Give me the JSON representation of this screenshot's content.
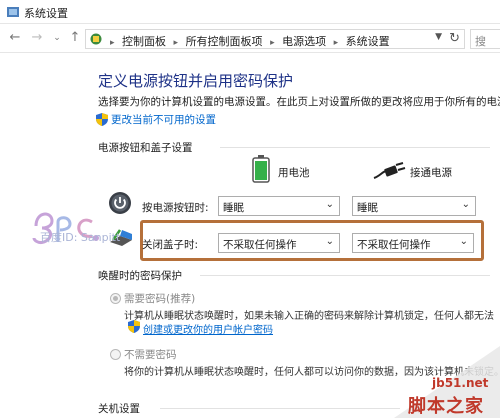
{
  "window": {
    "title": "系统设置"
  },
  "address": {
    "crumbs": [
      "控制面板",
      "所有控制面板项",
      "电源选项",
      "系统设置"
    ],
    "search_partial": "搜"
  },
  "page": {
    "title": "定义电源按钮并启用密码保护",
    "description": "选择要为你的计算机设置的电源设置。在此页上对设置所做的更改将应用于你所有的电源计",
    "change_unavailable_link": "更改当前不可用的设置"
  },
  "power_section": {
    "title": "电源按钮和盖子设置",
    "col_battery": "用电池",
    "col_plugged": "接通电源",
    "rows": [
      {
        "label": "按电源按钮时:",
        "battery": "睡眠",
        "plugged": "睡眠"
      },
      {
        "label": "关闭盖子时:",
        "battery": "不采取任何操作",
        "plugged": "不采取任何操作"
      }
    ]
  },
  "wake_section": {
    "title": "唤醒时的密码保护",
    "options": [
      {
        "label": "需要密码(推荐)",
        "desc": "计算机从睡眠状态唤醒时，如果未输入正确的密码来解除计算机锁定，任何人都无法",
        "link": "创建或更改你的用户帐户密码",
        "selected": true
      },
      {
        "label": "不需要密码",
        "desc": "将你的计算机从睡眠状态唤醒时，任何人都可以访问你的数据，因为该计算机未锁定。",
        "selected": false
      }
    ]
  },
  "shutdown_section": {
    "title": "关机设置"
  },
  "watermarks": {
    "author": "百度ID: Sanpitt",
    "site_url": "jb51.net",
    "site_name": "脚本之家"
  },
  "colors": {
    "heading": "#1e3287",
    "link": "#0066cc",
    "highlight_border": "#b5703a"
  },
  "icons": [
    "settings-app-icon",
    "back-arrow-icon",
    "forward-arrow-icon",
    "recent-dropdown-icon",
    "up-arrow-icon",
    "control-panel-icon",
    "refresh-icon",
    "uac-shield-icon",
    "battery-icon",
    "power-plug-icon",
    "power-button-icon",
    "laptop-lid-icon"
  ]
}
